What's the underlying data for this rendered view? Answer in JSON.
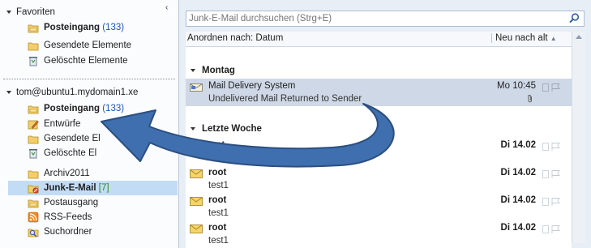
{
  "nav": {
    "favorites": {
      "heading": "Favoriten",
      "items": [
        {
          "label": "Posteingang",
          "count": "(133)"
        },
        {
          "label": "Gesendete Elemente"
        },
        {
          "label": "Gelöschte Elemente"
        }
      ]
    },
    "account": {
      "heading": "tom@ubuntu1.mydomain1.xe",
      "items": [
        {
          "label": "Posteingang",
          "count": "(133)"
        },
        {
          "label": "Entwürfe"
        },
        {
          "label": "Gesendete El"
        },
        {
          "label": "Gelöschte El"
        },
        {
          "label": "Archiv2011"
        },
        {
          "label": "Junk-E-Mail",
          "count": "[7]"
        },
        {
          "label": "Postausgang"
        },
        {
          "label": "RSS-Feeds"
        },
        {
          "label": "Suchordner"
        }
      ]
    }
  },
  "list": {
    "search_placeholder": "Junk-E-Mail durchsuchen (Strg+E)",
    "arrange_label": "Anordnen nach: Datum",
    "sort_order": "Neu nach alt",
    "groups": [
      {
        "label": "Montag"
      },
      {
        "label": "Letzte Woche"
      }
    ],
    "messages": [
      {
        "from": "Mail Delivery System",
        "subject": "Undelivered Mail Returned to Sender",
        "date": "Mo 10:45",
        "attachment": true
      },
      {
        "from": "root",
        "subject": "test1",
        "date": "Di 14.02"
      },
      {
        "from": "root",
        "subject": "test1",
        "date": "Di 14.02"
      },
      {
        "from": "root",
        "subject": "test1",
        "date": "Di 14.02"
      },
      {
        "from": "root",
        "subject": "test1",
        "date": "Di 14.02"
      }
    ]
  },
  "colors": {
    "arrow_fill": "#3f6fae",
    "arrow_stroke": "#2b4f80",
    "count_blue": "#1f56b5",
    "count_green": "#2d8a2d",
    "selected_folder": "#c3dcf5",
    "selected_message": "#cfd8e6"
  }
}
